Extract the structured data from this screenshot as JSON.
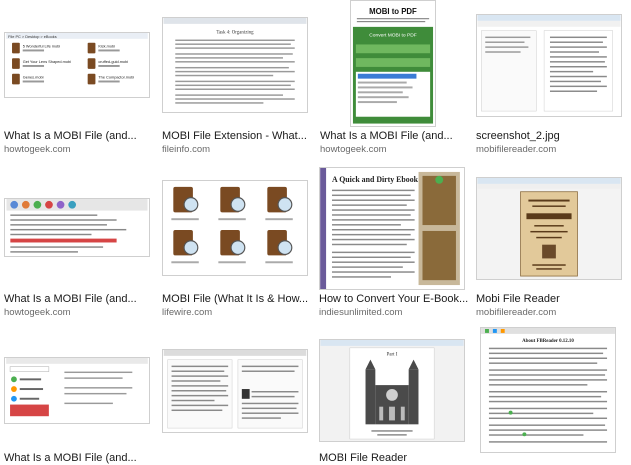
{
  "results": [
    {
      "title": "What Is a MOBI File (and...",
      "source": "howtogeek.com"
    },
    {
      "title": "MOBI File Extension - What...",
      "source": "fileinfo.com"
    },
    {
      "title": "What Is a MOBI File (and...",
      "source": "howtogeek.com"
    },
    {
      "title": "screenshot_2.jpg",
      "source": "mobifilereader.com"
    },
    {
      "title": "What Is a MOBI File (and...",
      "source": "howtogeek.com"
    },
    {
      "title": "MOBI File (What It Is & How...",
      "source": "lifewire.com"
    },
    {
      "title": "How to Convert Your E-Book...",
      "source": "indiesunlimited.com"
    },
    {
      "title": "Mobi File Reader",
      "source": "mobifilereader.com"
    },
    {
      "title": "What Is a MOBI File (and...",
      "source": ""
    },
    {
      "title": "",
      "source": ""
    },
    {
      "title": "MOBI File Reader",
      "source": ""
    },
    {
      "title": "",
      "source": ""
    }
  ],
  "thumbs": {
    "t1": {
      "label1": "5 Wonderful Life mobi",
      "label2": "Kick.mobi",
      "label3": "Get Your Lens Shaped.mobi",
      "label4": "cruffed-guid.mobi",
      "label5": "Genes.mobi",
      "label6": "The Compactor.mobi"
    },
    "t2": {
      "heading": "Task 4: Organizing"
    },
    "t3": {
      "heading": "MOBI to PDF",
      "button": "Convert MOBI to PDF"
    },
    "t7": {
      "heading": "A Quick and Dirty Ebook"
    },
    "t10": {
      "heading": "Part I"
    },
    "t12": {
      "heading": "About FBReader 0.12.10"
    }
  }
}
